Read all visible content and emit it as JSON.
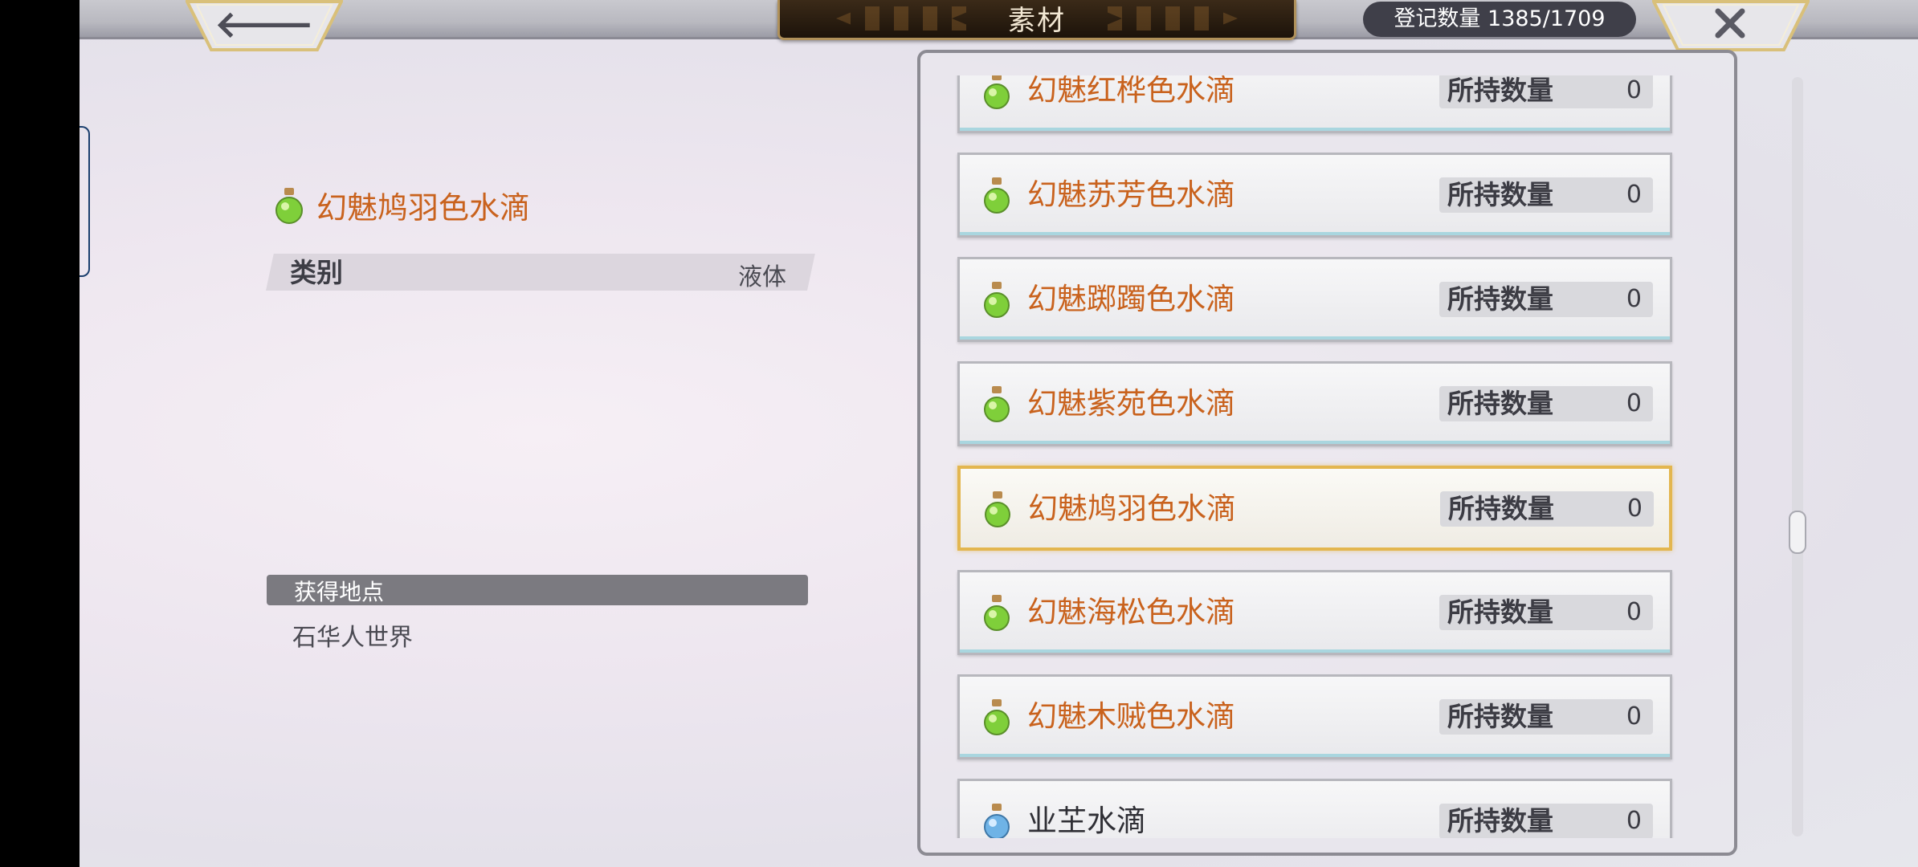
{
  "header": {
    "title": "素材",
    "registered_count": "登记数量 1385/1709",
    "back_icon": "back-arrow-icon",
    "close_icon": "close-x-icon"
  },
  "detail": {
    "item_name": "幻魅鸠羽色水滴",
    "icon": "green-potion-icon",
    "category_label": "类别",
    "category_value": "液体",
    "source_label": "获得地点",
    "source_value": "石华人世界"
  },
  "list": {
    "items": [
      {
        "name": "幻魅红桦色水滴",
        "qty_label": "所持数量",
        "qty": "0",
        "icon": "green-potion-icon"
      },
      {
        "name": "幻魅苏芳色水滴",
        "qty_label": "所持数量",
        "qty": "0",
        "icon": "green-potion-icon"
      },
      {
        "name": "幻魅踯躅色水滴",
        "qty_label": "所持数量",
        "qty": "0",
        "icon": "green-potion-icon"
      },
      {
        "name": "幻魅紫苑色水滴",
        "qty_label": "所持数量",
        "qty": "0",
        "icon": "green-potion-icon"
      },
      {
        "name": "幻魅鸠羽色水滴",
        "qty_label": "所持数量",
        "qty": "0",
        "icon": "green-potion-icon",
        "selected": true
      },
      {
        "name": "幻魅海松色水滴",
        "qty_label": "所持数量",
        "qty": "0",
        "icon": "green-potion-icon"
      },
      {
        "name": "幻魅木贼色水滴",
        "qty_label": "所持数量",
        "qty": "0",
        "icon": "green-potion-icon"
      },
      {
        "name": "业芏水滴",
        "qty_label": "所持数量",
        "qty": "0",
        "icon": "blue-potion-icon"
      }
    ]
  },
  "colors": {
    "item_name": "#c9621d",
    "selected_border": "#e3b64f",
    "title_plate": "#1c130a"
  }
}
